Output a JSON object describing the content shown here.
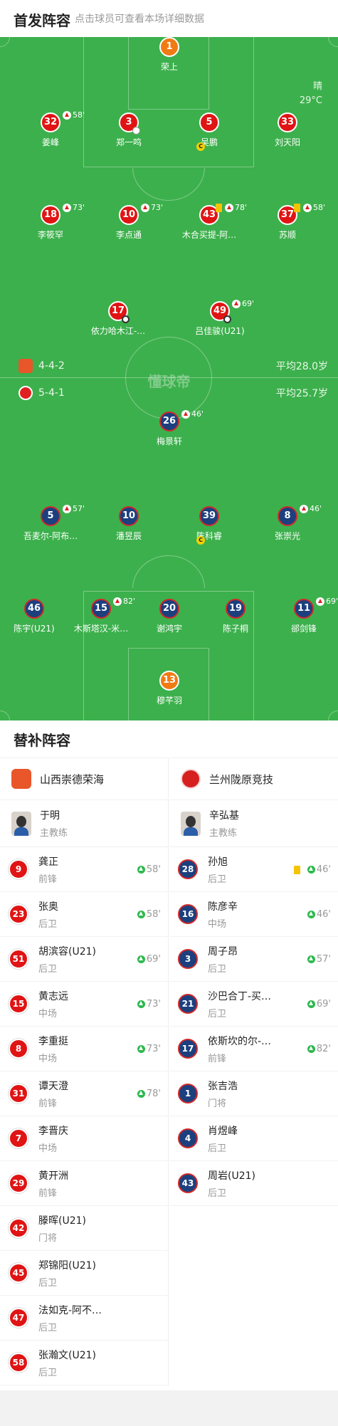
{
  "header": {
    "title": "首发阵容",
    "subtitle": "点击球员可查看本场详细数据"
  },
  "weather": {
    "condition": "晴",
    "temperature": "29°C"
  },
  "watermark": "懂球帝",
  "home_formation": {
    "formation": "4-4-2",
    "avg_age": "平均28.0岁"
  },
  "away_formation": {
    "formation": "5-4-1",
    "avg_age": "平均25.7岁"
  },
  "colors": {
    "pitch": "#3cb04c",
    "home": "#e01414",
    "away": "#1c3f7e",
    "gk_home": "#f07a14"
  },
  "pitch": {
    "home": [
      {
        "num": "1",
        "name": "荣上",
        "style": "org"
      },
      {
        "num": "32",
        "name": "姜峰",
        "sub": "58'",
        "style": "red"
      },
      {
        "num": "3",
        "name": "郑一鸣",
        "swap": true,
        "style": "red"
      },
      {
        "num": "5",
        "name": "吴鹏",
        "captain": true,
        "style": "red"
      },
      {
        "num": "33",
        "name": "刘天阳",
        "style": "red"
      },
      {
        "num": "18",
        "name": "李筱罕",
        "sub": "73'",
        "style": "red"
      },
      {
        "num": "10",
        "name": "李点通",
        "sub": "73'",
        "style": "red"
      },
      {
        "num": "43",
        "name": "木合买提-阿…",
        "sub": "78'",
        "yellow": true,
        "style": "red"
      },
      {
        "num": "37",
        "name": "苏顺",
        "sub": "58'",
        "yellow": true,
        "style": "red"
      },
      {
        "num": "17",
        "name": "依力哈木江-…",
        "goal": true,
        "style": "red"
      },
      {
        "num": "49",
        "name": "吕佳骏(U21)",
        "sub": "69'",
        "goal": true,
        "style": "red"
      }
    ],
    "away": [
      {
        "num": "26",
        "name": "梅景轩",
        "sub": "46'",
        "style": "blu"
      },
      {
        "num": "5",
        "name": "吾麦尔-阿布…",
        "sub": "57'",
        "style": "blu"
      },
      {
        "num": "10",
        "name": "潘昱辰",
        "style": "blu"
      },
      {
        "num": "39",
        "name": "陈科睿",
        "captain": true,
        "style": "blu"
      },
      {
        "num": "8",
        "name": "张崇光",
        "sub": "46'",
        "style": "blu"
      },
      {
        "num": "46",
        "name": "陈宇(U21)",
        "style": "blu"
      },
      {
        "num": "15",
        "name": "木斯塔汉-米…",
        "sub": "82'",
        "style": "blu"
      },
      {
        "num": "20",
        "name": "谢鸿宇",
        "style": "blu"
      },
      {
        "num": "19",
        "name": "陈子桐",
        "style": "blu"
      },
      {
        "num": "11",
        "name": "郤剑锋",
        "sub": "69'",
        "style": "blu"
      },
      {
        "num": "13",
        "name": "穆芊羽",
        "style": "org"
      }
    ]
  },
  "subs_title": "替补阵容",
  "home_team": {
    "name": "山西崇德荣海",
    "coach": {
      "name": "于明",
      "role": "主教练"
    },
    "subs": [
      {
        "num": "9",
        "name": "龚正",
        "pos": "前锋",
        "in": "58'"
      },
      {
        "num": "23",
        "name": "张奥",
        "pos": "后卫",
        "in": "58'"
      },
      {
        "num": "51",
        "name": "胡滨容(U21)",
        "pos": "后卫",
        "in": "69'"
      },
      {
        "num": "15",
        "name": "黄志远",
        "pos": "中场",
        "in": "73'"
      },
      {
        "num": "8",
        "name": "李重挺",
        "pos": "中场",
        "in": "73'"
      },
      {
        "num": "31",
        "name": "谭天澄",
        "pos": "前锋",
        "in": "78'"
      },
      {
        "num": "7",
        "name": "李晋庆",
        "pos": "中场"
      },
      {
        "num": "29",
        "name": "黄开洲",
        "pos": "前锋"
      },
      {
        "num": "42",
        "name": "滕晖(U21)",
        "pos": "门将"
      },
      {
        "num": "45",
        "name": "郑锦阳(U21)",
        "pos": "后卫"
      },
      {
        "num": "47",
        "name": "法如克-阿不…",
        "pos": "后卫"
      },
      {
        "num": "58",
        "name": "张瀚文(U21)",
        "pos": "后卫"
      }
    ]
  },
  "away_team": {
    "name": "兰州陇原竞技",
    "coach": {
      "name": "辛弘基",
      "role": "主教练"
    },
    "subs": [
      {
        "num": "28",
        "name": "孙旭",
        "pos": "后卫",
        "in": "46'",
        "yellow": true
      },
      {
        "num": "16",
        "name": "陈彦辛",
        "pos": "中场",
        "in": "46'"
      },
      {
        "num": "3",
        "name": "周子昂",
        "pos": "后卫",
        "in": "57'"
      },
      {
        "num": "21",
        "name": "沙巴合丁-买…",
        "pos": "后卫",
        "in": "69'"
      },
      {
        "num": "17",
        "name": "依斯坎的尔-…",
        "pos": "前锋",
        "in": "82'"
      },
      {
        "num": "1",
        "name": "张吉浩",
        "pos": "门将"
      },
      {
        "num": "4",
        "name": "肖煜峰",
        "pos": "后卫"
      },
      {
        "num": "43",
        "name": "周岩(U21)",
        "pos": "后卫"
      }
    ]
  }
}
